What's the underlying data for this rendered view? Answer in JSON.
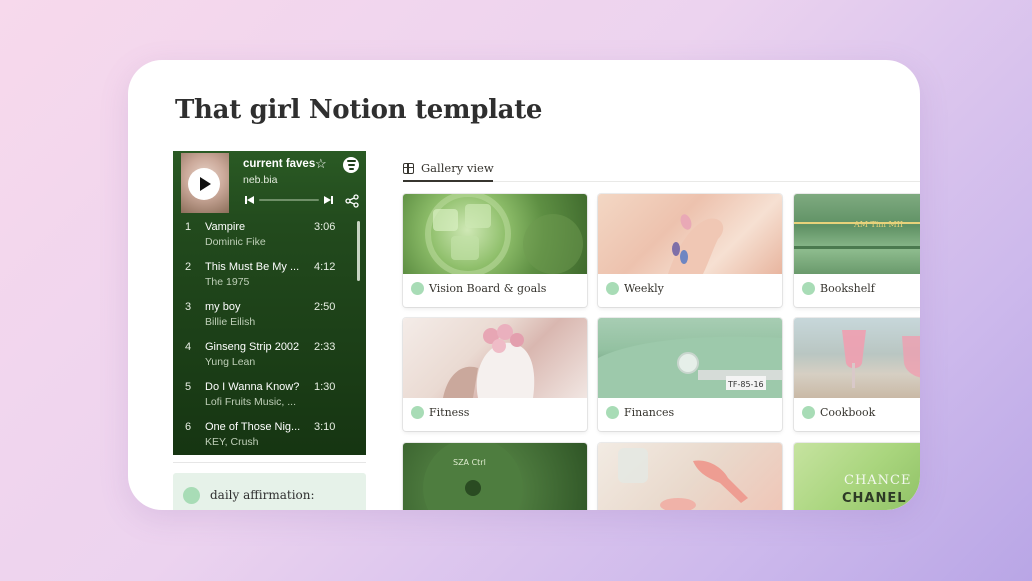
{
  "page": {
    "title": "That girl Notion template"
  },
  "spotify": {
    "playlist_title": "current faves",
    "playlist_star": "☆",
    "owner": "neb.bia",
    "tracks": [
      {
        "num": "1",
        "title": "Vampire",
        "artist": "Dominic Fike",
        "duration": "3:06"
      },
      {
        "num": "2",
        "title": "This Must Be My ...",
        "artist": "The 1975",
        "duration": "4:12"
      },
      {
        "num": "3",
        "title": "my boy",
        "artist": "Billie Eilish",
        "duration": "2:50"
      },
      {
        "num": "4",
        "title": "Ginseng Strip 2002",
        "artist": "Yung Lean",
        "duration": "2:33"
      },
      {
        "num": "5",
        "title": "Do I Wanna Know?",
        "artist": "Lofi Fruits Music, ...",
        "duration": "1:30"
      },
      {
        "num": "6",
        "title": "One of Those Nig...",
        "artist": "KEY, Crush",
        "duration": "3:10"
      }
    ]
  },
  "callout": {
    "text": "daily affirmation:"
  },
  "gallery": {
    "view_label": "Gallery view",
    "cards": [
      {
        "label": "Vision Board & goals",
        "icon": "green-circle-icon"
      },
      {
        "label": "Weekly",
        "icon": "green-circle-icon"
      },
      {
        "label": "Bookshelf",
        "icon": "green-circle-icon"
      },
      {
        "label": "Fitness",
        "icon": "green-circle-icon"
      },
      {
        "label": "Finances",
        "icon": "green-circle-icon"
      },
      {
        "label": "Cookbook",
        "icon": "green-circle-icon"
      }
    ],
    "image_text": {
      "bookshelf_spine": "AM Tim MII",
      "car_plate": "TF-85-16",
      "record_label": "SZA Ctrl",
      "bag_brand_1": "CHANCE",
      "bag_brand_2": "CHANEL"
    }
  },
  "colors": {
    "spotify_green": "#245020",
    "callout_bg": "#e6f2e9",
    "accent_dot": "#a8dcb6"
  }
}
